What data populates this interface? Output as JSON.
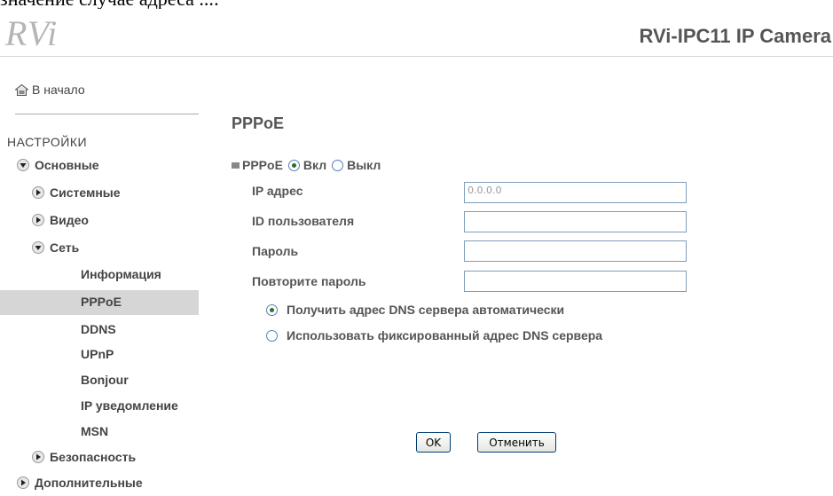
{
  "doc_fragment": "значение случае адреса ...:",
  "header": {
    "logo": "RVi",
    "title": "RVi-IPC11 IP Camera"
  },
  "sidebar": {
    "home": "В начало",
    "settings_title": "НАСТРОЙКИ",
    "items": [
      {
        "label": "Основные",
        "state": "expanded"
      },
      {
        "label": "Системные",
        "state": "collapsed"
      },
      {
        "label": "Видео",
        "state": "collapsed"
      },
      {
        "label": "Сеть",
        "state": "expanded"
      },
      {
        "label": "Безопасность",
        "state": "collapsed"
      },
      {
        "label": "Дополнительные",
        "state": "collapsed"
      }
    ],
    "network_subitems": [
      "Информация",
      "PPPoE",
      "DDNS",
      "UPnP",
      "Bonjour",
      "IP уведомление",
      "MSN"
    ],
    "active_subitem": "PPPoE"
  },
  "main": {
    "page_title": "PPPoE",
    "pppoe_label": "PPPoE",
    "on_label": "Вкл",
    "off_label": "Выкл",
    "pppoe_state": "on",
    "fields": [
      {
        "label": "IP адрес",
        "value": "0.0.0.0"
      },
      {
        "label": "ID пользователя",
        "value": ""
      },
      {
        "label": "Пароль",
        "value": ""
      },
      {
        "label": "Повторите пароль",
        "value": ""
      }
    ],
    "dns_auto_label": "Получить адрес DNS сервера автоматически",
    "dns_fixed_label": "Использовать фиксированный адрес DNS сервера",
    "dns_mode": "auto",
    "ok_label": "OK",
    "cancel_label": "Отменить"
  },
  "colors": {
    "active_item_bg": "#d6d6d6",
    "input_border": "#7f9db9",
    "radio_dot": "#2e6e2e"
  }
}
